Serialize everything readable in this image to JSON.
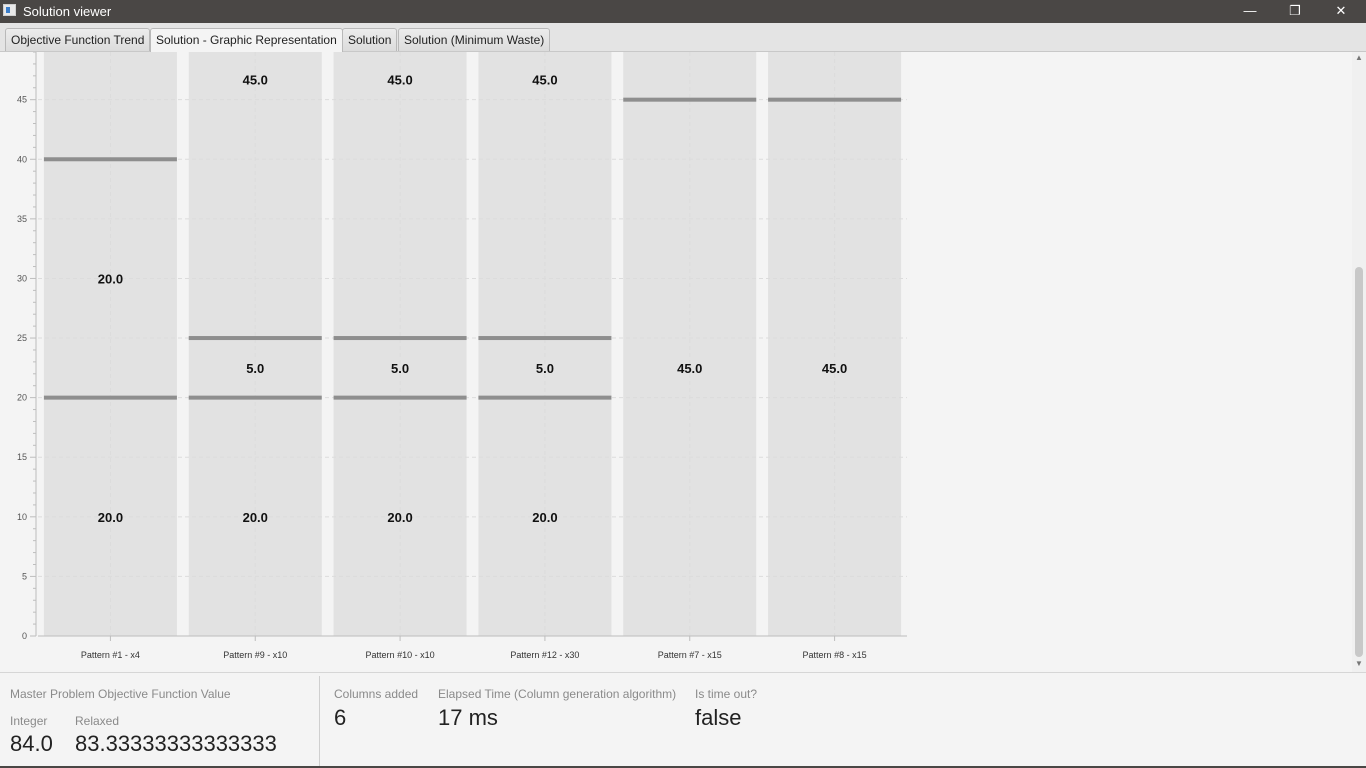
{
  "window": {
    "title": "Solution viewer",
    "controls": {
      "minimize": "—",
      "restore": "❐",
      "close": "✕"
    }
  },
  "tabs": [
    {
      "label": "Objective Function Trend",
      "active": false
    },
    {
      "label": "Solution - Graphic Representation",
      "active": true
    },
    {
      "label": "Solution",
      "active": false
    },
    {
      "label": "Solution (Minimum Waste)",
      "active": false
    }
  ],
  "chart_data": {
    "type": "bar",
    "stacked": true,
    "grid": true,
    "ylim": [
      0,
      49
    ],
    "y_ticks": [
      0,
      5,
      10,
      15,
      20,
      25,
      30,
      35,
      40,
      45
    ],
    "categories": [
      "Pattern #1 - x4",
      "Pattern #9 - x10",
      "Pattern #10 - x10",
      "Pattern #12 - x30",
      "Pattern #7 - x15",
      "Pattern #8 - x15"
    ],
    "bars": [
      {
        "segments": [
          20.0,
          20.0
        ]
      },
      {
        "segments": [
          20.0,
          5.0,
          45.0
        ]
      },
      {
        "segments": [
          20.0,
          5.0,
          45.0
        ]
      },
      {
        "segments": [
          20.0,
          5.0,
          45.0
        ]
      },
      {
        "segments": [
          45.0
        ]
      },
      {
        "segments": [
          45.0
        ]
      }
    ],
    "colors": {
      "bar_fill": "#e2e2e2",
      "segment_line": "#8e8e8e",
      "grid": "#dcdcdc"
    }
  },
  "status": {
    "objective_title": "Master Problem Objective Function Value",
    "integer_label": "Integer",
    "integer_value": "84.0",
    "relaxed_label": "Relaxed",
    "relaxed_value": "83.33333333333333",
    "columns_label": "Columns added",
    "columns_value": "6",
    "elapsed_label": "Elapsed Time (Column generation algorithm)",
    "elapsed_value": "17 ms",
    "timeout_label": "Is time out?",
    "timeout_value": "false"
  }
}
